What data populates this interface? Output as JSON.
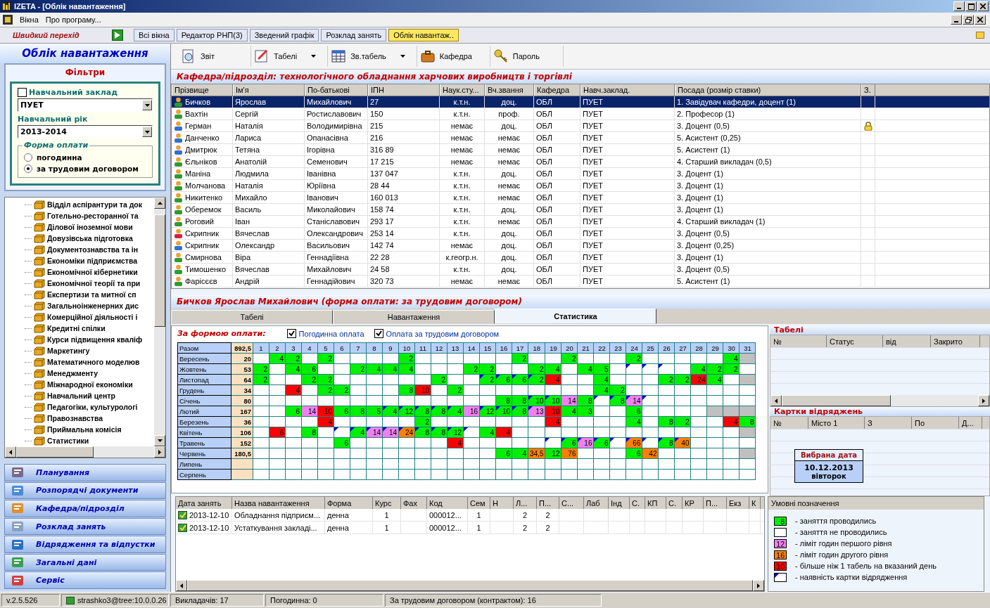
{
  "window": {
    "title": "IZETA - [Облік навантаження]"
  },
  "menu": [
    "Вікна",
    "Про програму..."
  ],
  "quick_nav": {
    "label": "Швидкий перехід",
    "tabs": [
      {
        "label": "Всі вікна",
        "selected": false
      },
      {
        "label": "Редактор РНП(3)",
        "selected": false
      },
      {
        "label": "Зведений графік",
        "selected": false
      },
      {
        "label": "Розклад занять",
        "selected": false
      },
      {
        "label": "Облік навантаж..",
        "selected": true
      }
    ]
  },
  "sidebar": {
    "title": "Облік навантаження",
    "filters": {
      "title": "Фільтри",
      "institution": {
        "label": "Навчальний заклад",
        "checked": false,
        "value": "ПУЕТ"
      },
      "year": {
        "label": "Навчальний рік",
        "value": "2013-2014"
      },
      "payment": {
        "title": "Форма оплати",
        "options": [
          {
            "label": "погодинна",
            "selected": false
          },
          {
            "label": "за трудовим договором",
            "selected": true
          }
        ]
      }
    },
    "tree": [
      "Відділ аспірантури та док",
      "Готельно-ресторанної та",
      "Ділової іноземної мови",
      "Довузівська підготовка",
      "Документознавства та ін",
      "Економіки підприємства",
      "Економічної кібернетики",
      "Економічної теорії та при",
      "Експертизи та митної сп",
      "Загальноінженерних дис",
      "Комерційної діяльності і",
      "Кредитні спілки",
      "Курси підвищення кваліф",
      "Маркетингу",
      "Математичного моделюв",
      "Менеджменту",
      "Міжнародної економіки",
      "Навчальний центр",
      "Педагогіки, культурологі",
      "Правознавства",
      "Приймальна комісія",
      "Статистики"
    ],
    "nav": [
      "Планування",
      "Розпорядчі документи",
      "Кафедра/підрозділ",
      "Розклад занять",
      "Відрядження та відпустки",
      "Загальні дані",
      "Сервіс"
    ]
  },
  "toolbar": [
    {
      "label": "Звіт",
      "kind": "report",
      "dropdown": false
    },
    {
      "label": "Табелі",
      "kind": "edit",
      "dropdown": true
    },
    {
      "label": "Зв.табель",
      "kind": "table",
      "dropdown": true
    },
    {
      "label": "Кафедра",
      "kind": "case",
      "dropdown": false
    },
    {
      "label": "Пароль",
      "kind": "keys",
      "dropdown": false
    }
  ],
  "department": "Кафедра/підрозділ: технологічного обладнання харчових виробництв і торгівлі",
  "staff": {
    "columns": [
      "Прізвище",
      "Ім'я",
      "По-батькові",
      "ІПН",
      "Наук.сту...",
      "Вч.звання",
      "Кафедра",
      "Навч.заклад.",
      "Посада (розмір ставки)",
      "З."
    ],
    "rows": [
      {
        "surname": "Бичков",
        "name": "Ярослав",
        "patronymic": "Михайлович",
        "ipn": "27",
        "degree": "к.т.н.",
        "rank": "доц.",
        "dept": "ОБЛ",
        "inst": "ПУЕТ",
        "position": "1. Завідувач кафедри, доцент (1)",
        "locked": false,
        "selected": true,
        "color": "#2f9a2f"
      },
      {
        "surname": "Вахтін",
        "name": "Сергій",
        "patronymic": "Ростиславович",
        "ipn": "150",
        "degree": "к.т.н.",
        "rank": "проф.",
        "dept": "ОБЛ",
        "inst": "ПУЕТ",
        "position": "2. Професор (1)",
        "locked": false,
        "selected": false,
        "color": "#2f9a2f"
      },
      {
        "surname": "Герман",
        "name": "Наталія",
        "patronymic": "Володимирівна",
        "ipn": "215",
        "degree": "немає",
        "rank": "доц.",
        "dept": "ОБЛ",
        "inst": "ПУЕТ",
        "position": "3. Доцент (0,5)",
        "locked": true,
        "selected": false,
        "color": "#2f6fd6"
      },
      {
        "surname": "Данченко",
        "name": "Лариса",
        "patronymic": "Опанасівна",
        "ipn": "216",
        "degree": "немає",
        "rank": "немає",
        "dept": "ОБЛ",
        "inst": "ПУЕТ",
        "position": "5. Асистент (0,25)",
        "locked": false,
        "selected": false,
        "color": "#2f6fd6"
      },
      {
        "surname": "Дмитрюк",
        "name": "Тетяна",
        "patronymic": "Ігорівна",
        "ipn": "316 89",
        "degree": "немає",
        "rank": "немає",
        "dept": "ОБЛ",
        "inst": "ПУЕТ",
        "position": "5. Асистент (1)",
        "locked": false,
        "selected": false,
        "color": "#2f6fd6"
      },
      {
        "surname": "Єльніков",
        "name": "Анатолій",
        "patronymic": "Семенович",
        "ipn": "17 215",
        "degree": "немає",
        "rank": "немає",
        "dept": "ОБЛ",
        "inst": "ПУЕТ",
        "position": "4. Старший викладач (0,5)",
        "locked": false,
        "selected": false,
        "color": "#2f9a2f"
      },
      {
        "surname": "Маніна",
        "name": "Людмила",
        "patronymic": "Іванівна",
        "ipn": "137 047",
        "degree": "к.т.н.",
        "rank": "доц.",
        "dept": "ОБЛ",
        "inst": "ПУЕТ",
        "position": "3. Доцент (1)",
        "locked": false,
        "selected": false,
        "color": "#2f9a2f"
      },
      {
        "surname": "Молчанова",
        "name": "Наталія",
        "patronymic": "Юріївна",
        "ipn": "28 44",
        "degree": "к.т.н.",
        "rank": "немає",
        "dept": "ОБЛ",
        "inst": "ПУЕТ",
        "position": "3. Доцент (1)",
        "locked": false,
        "selected": false,
        "color": "#2f9a2f"
      },
      {
        "surname": "Никитенко",
        "name": "Михайло",
        "patronymic": "Іванович",
        "ipn": "160 013",
        "degree": "к.т.н.",
        "rank": "немає",
        "dept": "ОБЛ",
        "inst": "ПУЕТ",
        "position": "3. Доцент (1)",
        "locked": false,
        "selected": false,
        "color": "#2f9a2f"
      },
      {
        "surname": "Оберемок",
        "name": "Василь",
        "patronymic": "Миколайович",
        "ipn": "158 74",
        "degree": "к.т.н.",
        "rank": "доц.",
        "dept": "ОБЛ",
        "inst": "ПУЕТ",
        "position": "3. Доцент (1)",
        "locked": false,
        "selected": false,
        "color": "#2f9a2f"
      },
      {
        "surname": "Роговий",
        "name": "Іван",
        "patronymic": "Станіславович",
        "ipn": "293 17",
        "degree": "к.т.н.",
        "rank": "немає",
        "dept": "ОБЛ",
        "inst": "ПУЕТ",
        "position": "4. Старший викладач (1)",
        "locked": false,
        "selected": false,
        "color": "#2f9a2f"
      },
      {
        "surname": "Скрипник",
        "name": "Вячеслав",
        "patronymic": "Олександрович",
        "ipn": "253 14",
        "degree": "к.т.н.",
        "rank": "доц.",
        "dept": "ОБЛ",
        "inst": "ПУЕТ",
        "position": "3. Доцент (0,5)",
        "locked": false,
        "selected": false,
        "color": "#d6203a"
      },
      {
        "surname": "Скрипник",
        "name": "Олександр",
        "patronymic": "Васильович",
        "ipn": "142 74",
        "degree": "немає",
        "rank": "доц.",
        "dept": "ОБЛ",
        "inst": "ПУЕТ",
        "position": "3. Доцент (0,25)",
        "locked": false,
        "selected": false,
        "color": "#2f6fd6"
      },
      {
        "surname": "Смирнова",
        "name": "Віра",
        "patronymic": "Геннадіївна",
        "ipn": "22 28",
        "degree": "к.геогр.н.",
        "rank": "доц.",
        "dept": "ОБЛ",
        "inst": "ПУЕТ",
        "position": "3. Доцент (1)",
        "locked": false,
        "selected": false,
        "color": "#2f9a2f"
      },
      {
        "surname": "Тимошенко",
        "name": "Вячеслав",
        "patronymic": "Михайлович",
        "ipn": "24 58",
        "degree": "к.т.н.",
        "rank": "доц.",
        "dept": "ОБЛ",
        "inst": "ПУЕТ",
        "position": "3. Доцент (0,5)",
        "locked": false,
        "selected": false,
        "color": "#2f9a2f"
      },
      {
        "surname": "Фарісєєв",
        "name": "Андрій",
        "patronymic": "Геннадійович",
        "ipn": "320 73",
        "degree": "немає",
        "rank": "немає",
        "dept": "ОБЛ",
        "inst": "ПУЕТ",
        "position": "5. Асистент (1)",
        "locked": false,
        "selected": false,
        "color": "#2f9a2f"
      }
    ]
  },
  "person": "Бичков Ярослав Михайлович (форма оплати: за трудовим договором)",
  "detail_tabs": [
    {
      "label": "Табелі",
      "selected": false
    },
    {
      "label": "Навантаження",
      "selected": false
    },
    {
      "label": "Статистика",
      "selected": true
    }
  ],
  "stats": {
    "title": "За формою оплати:",
    "options": [
      {
        "label": "Погодинна оплата",
        "checked": true
      },
      {
        "label": "Оплата за трудовим договором",
        "checked": true
      }
    ],
    "total_label": "Разом",
    "total": "892,5",
    "days": [
      "1",
      "2",
      "3",
      "4",
      "5",
      "6",
      "7",
      "8",
      "9",
      "10",
      "11",
      "12",
      "13",
      "14",
      "15",
      "16",
      "17",
      "18",
      "19",
      "20",
      "21",
      "22",
      "23",
      "24",
      "25",
      "26",
      "27",
      "28",
      "29",
      "30",
      "31"
    ],
    "months": [
      {
        "name": "Вересень",
        "total": "20",
        "cells": [
          null,
          {
            "value": "4",
            "kind": "held",
            "trip": false
          },
          {
            "value": "2",
            "kind": "held",
            "trip": false
          },
          null,
          {
            "value": "2",
            "kind": "held",
            "trip": false
          },
          null,
          null,
          null,
          null,
          {
            "value": "2",
            "kind": "held",
            "trip": false
          },
          null,
          null,
          null,
          null,
          null,
          null,
          {
            "value": "2",
            "kind": "held",
            "trip": false
          },
          null,
          null,
          {
            "value": "2",
            "kind": "held",
            "trip": false
          },
          null,
          null,
          null,
          {
            "value": "2",
            "kind": "held",
            "trip": false
          },
          null,
          null,
          null,
          null,
          null,
          {
            "value": "4",
            "kind": "held",
            "trip": false
          },
          {
            "kind": "none",
            "trip": false
          }
        ]
      },
      {
        "name": "Жовтень",
        "total": "53",
        "cells": [
          {
            "value": "2",
            "kind": "held",
            "trip": false
          },
          null,
          {
            "value": "4",
            "kind": "held",
            "trip": false
          },
          {
            "value": "6",
            "kind": "held",
            "trip": false
          },
          null,
          null,
          {
            "value": "2",
            "kind": "held",
            "trip": false
          },
          {
            "value": "4",
            "kind": "held",
            "trip": false
          },
          {
            "value": "4",
            "kind": "held",
            "trip": false
          },
          {
            "value": "4",
            "kind": "held",
            "trip": false
          },
          null,
          null,
          null,
          {
            "value": "2",
            "kind": "held",
            "trip": false
          },
          {
            "value": "2",
            "kind": "held",
            "trip": false
          },
          null,
          null,
          {
            "value": "2",
            "kind": "held",
            "trip": false
          },
          {
            "value": "4",
            "kind": "held",
            "trip": false
          },
          null,
          {
            "value": "4",
            "kind": "held",
            "trip": false
          },
          {
            "value": "5",
            "kind": "held",
            "trip": false
          },
          null,
          {
            "kind": "empty",
            "trip": true
          },
          {
            "kind": "empty",
            "trip": true
          },
          {
            "kind": "empty",
            "trip": true
          },
          null,
          {
            "value": "4",
            "kind": "held",
            "trip": false
          },
          {
            "value": "2",
            "kind": "held",
            "trip": false
          },
          {
            "value": "2",
            "kind": "held",
            "trip": false
          },
          null
        ]
      },
      {
        "name": "Листопад",
        "total": "64",
        "cells": [
          {
            "value": "2",
            "kind": "held",
            "trip": false
          },
          null,
          null,
          {
            "value": "2",
            "kind": "held",
            "trip": false
          },
          {
            "value": "2",
            "kind": "held",
            "trip": false
          },
          null,
          null,
          null,
          null,
          null,
          null,
          {
            "value": "2",
            "kind": "held",
            "trip": false
          },
          null,
          null,
          {
            "value": "2",
            "kind": "held",
            "trip": true
          },
          {
            "value": "6",
            "kind": "held",
            "trip": true
          },
          {
            "value": "6",
            "kind": "held",
            "trip": true
          },
          {
            "value": "2",
            "kind": "held",
            "trip": true
          },
          {
            "value": "4",
            "kind": "conflict",
            "trip": false
          },
          null,
          null,
          {
            "value": "4",
            "kind": "held",
            "trip": false
          },
          null,
          null,
          null,
          {
            "value": "2",
            "kind": "held",
            "trip": false
          },
          {
            "value": "2",
            "kind": "held",
            "trip": false
          },
          {
            "value": "24",
            "kind": "conflict",
            "trip": false
          },
          {
            "value": "4",
            "kind": "held",
            "trip": false
          },
          null,
          {
            "kind": "none",
            "trip": false
          }
        ]
      },
      {
        "name": "Грудень",
        "total": "34",
        "cells": [
          null,
          null,
          {
            "value": "4",
            "kind": "conflict",
            "trip": false
          },
          null,
          {
            "value": "2",
            "kind": "held",
            "trip": false
          },
          {
            "value": "2",
            "kind": "held",
            "trip": false
          },
          null,
          null,
          null,
          {
            "value": "8",
            "kind": "held",
            "trip": false
          },
          {
            "value": "10",
            "kind": "conflict",
            "trip": false
          },
          null,
          {
            "value": "2",
            "kind": "held",
            "trip": false
          },
          null,
          null,
          null,
          null,
          null,
          null,
          null,
          null,
          {
            "value": "4",
            "kind": "held",
            "trip": false
          },
          {
            "value": "2",
            "kind": "held",
            "trip": false
          },
          null,
          null,
          null,
          null,
          null,
          null,
          null,
          null
        ]
      },
      {
        "name": "Січень",
        "total": "80",
        "cells": [
          null,
          null,
          null,
          null,
          null,
          null,
          null,
          null,
          null,
          null,
          null,
          null,
          null,
          null,
          null,
          {
            "value": "8",
            "kind": "held",
            "trip": false
          },
          {
            "value": "8",
            "kind": "held",
            "trip": false
          },
          {
            "value": "10",
            "kind": "held",
            "trip": true
          },
          {
            "value": "10",
            "kind": "held",
            "trip": true
          },
          {
            "value": "14",
            "kind": "limit1",
            "trip": false
          },
          {
            "value": "8",
            "kind": "held",
            "trip": false
          },
          {
            "kind": "empty",
            "trip": true
          },
          {
            "value": "8",
            "kind": "held",
            "trip": true
          },
          {
            "value": "14",
            "kind": "limit1",
            "trip": true
          },
          {
            "kind": "empty",
            "trip": true
          },
          null,
          null,
          null,
          null,
          null,
          null
        ]
      },
      {
        "name": "Лютий",
        "total": "167",
        "cells": [
          null,
          null,
          {
            "value": "6",
            "kind": "held",
            "trip": false
          },
          {
            "value": "14",
            "kind": "limit1",
            "trip": false
          },
          {
            "value": "10",
            "kind": "conflict",
            "trip": false
          },
          {
            "value": "6",
            "kind": "held",
            "trip": false
          },
          {
            "value": "8",
            "kind": "held",
            "trip": false
          },
          {
            "value": "5",
            "kind": "held",
            "trip": false
          },
          {
            "value": "4",
            "kind": "held",
            "trip": true
          },
          {
            "value": "12",
            "kind": "held",
            "trip": true
          },
          {
            "value": "8",
            "kind": "held",
            "trip": true
          },
          {
            "value": "8",
            "kind": "held",
            "trip": true
          },
          {
            "value": "4",
            "kind": "held",
            "trip": true
          },
          {
            "value": "16",
            "kind": "limit1",
            "trip": false
          },
          {
            "value": "12",
            "kind": "held",
            "trip": true
          },
          {
            "value": "10",
            "kind": "held",
            "trip": true
          },
          {
            "value": "8",
            "kind": "held",
            "trip": true
          },
          {
            "value": "13",
            "kind": "limit1",
            "trip": true
          },
          {
            "value": "10",
            "kind": "conflict",
            "trip": false
          },
          {
            "value": "4",
            "kind": "held",
            "trip": false
          },
          {
            "value": "3",
            "kind": "held",
            "trip": false
          },
          null,
          null,
          {
            "value": "6",
            "kind": "held",
            "trip": false
          },
          null,
          null,
          null,
          null,
          {
            "kind": "none",
            "trip": false
          },
          {
            "kind": "none",
            "trip": false
          },
          {
            "kind": "none",
            "trip": false
          }
        ]
      },
      {
        "name": "Березень",
        "total": "36",
        "cells": [
          null,
          null,
          null,
          null,
          {
            "value": "4",
            "kind": "conflict",
            "trip": false
          },
          null,
          null,
          null,
          null,
          null,
          {
            "value": "2",
            "kind": "held",
            "trip": false
          },
          null,
          null,
          null,
          null,
          null,
          null,
          null,
          {
            "value": "4",
            "kind": "conflict",
            "trip": false
          },
          null,
          null,
          null,
          null,
          {
            "value": "4",
            "kind": "held",
            "trip": false
          },
          null,
          {
            "value": "8",
            "kind": "held",
            "trip": false
          },
          {
            "value": "2",
            "kind": "held",
            "trip": false
          },
          null,
          null,
          {
            "value": "4",
            "kind": "conflict",
            "trip": false
          },
          {
            "value": "8",
            "kind": "held",
            "trip": false
          }
        ]
      },
      {
        "name": "Квітень",
        "total": "106",
        "cells": [
          null,
          {
            "value": "6",
            "kind": "conflict",
            "trip": false
          },
          null,
          {
            "value": "8",
            "kind": "held",
            "trip": false
          },
          null,
          {
            "kind": "empty",
            "trip": true
          },
          {
            "value": "4",
            "kind": "held",
            "trip": true
          },
          {
            "value": "14",
            "kind": "limit1",
            "trip": true
          },
          {
            "value": "14",
            "kind": "limit1",
            "trip": true
          },
          {
            "value": "24",
            "kind": "limit2",
            "trip": true
          },
          {
            "value": "8",
            "kind": "held",
            "trip": true
          },
          {
            "value": "8",
            "kind": "held",
            "trip": true
          },
          {
            "value": "12",
            "kind": "held",
            "trip": true
          },
          {
            "kind": "empty",
            "trip": true
          },
          {
            "value": "4",
            "kind": "held",
            "trip": false
          },
          {
            "value": "4",
            "kind": "conflict",
            "trip": false
          },
          null,
          null,
          null,
          null,
          null,
          null,
          null,
          null,
          null,
          null,
          null,
          null,
          null,
          null,
          {
            "kind": "none",
            "trip": false
          }
        ]
      },
      {
        "name": "Травень",
        "total": "152",
        "cells": [
          null,
          null,
          null,
          null,
          null,
          {
            "value": "6",
            "kind": "held",
            "trip": false
          },
          null,
          null,
          null,
          null,
          null,
          null,
          {
            "value": "4",
            "kind": "conflict",
            "trip": false
          },
          null,
          null,
          null,
          null,
          null,
          {
            "kind": "empty",
            "trip": true
          },
          {
            "value": "6",
            "kind": "held",
            "trip": true
          },
          {
            "value": "16",
            "kind": "limit1",
            "trip": true
          },
          {
            "value": "6",
            "kind": "held",
            "trip": true
          },
          {
            "kind": "empty",
            "trip": true
          },
          {
            "value": "66",
            "kind": "limit2",
            "trip": true
          },
          {
            "kind": "empty",
            "trip": true
          },
          {
            "value": "8",
            "kind": "held",
            "trip": true
          },
          {
            "value": "40",
            "kind": "limit2",
            "trip": true
          },
          null,
          null,
          null,
          null
        ]
      },
      {
        "name": "Червень",
        "total": "180,5",
        "cells": [
          null,
          null,
          null,
          null,
          null,
          null,
          null,
          null,
          null,
          null,
          null,
          null,
          null,
          null,
          null,
          {
            "value": "6",
            "kind": "held",
            "trip": false
          },
          {
            "value": "4",
            "kind": "held",
            "trip": false
          },
          {
            "value": "34,5",
            "kind": "limit2",
            "trip": false
          },
          {
            "value": "12",
            "kind": "held",
            "trip": false
          },
          {
            "value": "76",
            "kind": "limit2",
            "trip": false
          },
          null,
          null,
          null,
          {
            "value": "6",
            "kind": "held",
            "trip": false
          },
          {
            "value": "42",
            "kind": "limit2",
            "trip": false
          },
          null,
          null,
          null,
          null,
          null,
          {
            "kind": "none",
            "trip": false
          }
        ]
      },
      {
        "name": "Липень"
      },
      {
        "name": "Серпень"
      }
    ]
  },
  "timesheets": {
    "title": "Табелі",
    "columns": [
      "№",
      "Статус",
      "від",
      "Закрито"
    ]
  },
  "trips": {
    "title": "Картки відряджень",
    "columns": [
      "№",
      "Місто 1",
      "З",
      "По",
      "Д..."
    ]
  },
  "selected_date": {
    "title": "Вибрана дата",
    "date": "10.12.2013",
    "weekday": "вівторок"
  },
  "lessons": {
    "columns": [
      "Дата занять",
      "Назва навантаження",
      "Форма",
      "Курс",
      "Фах",
      "Код",
      "Сем",
      "Н",
      "Л...",
      "П...",
      "С...",
      "Лаб",
      "Інд",
      "С.",
      "КП",
      "С.",
      "КР",
      "П...",
      "Екз",
      "К"
    ],
    "rows": [
      {
        "date": "2013-12-10",
        "title": "Обладнання підприєм...",
        "form": "денна",
        "course": "1",
        "code": "000012...",
        "semester": "1",
        "lectures": "2",
        "practicals": "2"
      },
      {
        "date": "2013-12-10",
        "title": "Устаткування закладі...",
        "form": "денна",
        "course": "1",
        "code": "000012...",
        "semester": "1",
        "lectures": "2",
        "practicals": "2"
      }
    ]
  },
  "legend": {
    "title": "Умовні позначення",
    "items": [
      {
        "kind": "held",
        "value": "8",
        "label": "- заняття проводились",
        "trip": false
      },
      {
        "kind": "empty",
        "label": "- заняття не проводились",
        "trip": false
      },
      {
        "kind": "limit1",
        "value": "12",
        "label": "- ліміт годин першого рівня",
        "trip": false
      },
      {
        "kind": "limit2",
        "value": "16",
        "label": "- ліміт годин другого рівня",
        "trip": false
      },
      {
        "kind": "conflict",
        "value": "10",
        "label": "- більше ніж 1 табель на вказаний день",
        "trip": false
      },
      {
        "kind": "empty",
        "label": "- наявність картки відрядження",
        "trip": true
      }
    ]
  },
  "status_bar": {
    "version": "v.2.5.526",
    "user": "strashko3@tree:10.0.0.26",
    "teachers": "Викладачів: 17",
    "hourly": "Погодинна: 0",
    "contract": "За трудовим договором (контрактом): 16"
  }
}
